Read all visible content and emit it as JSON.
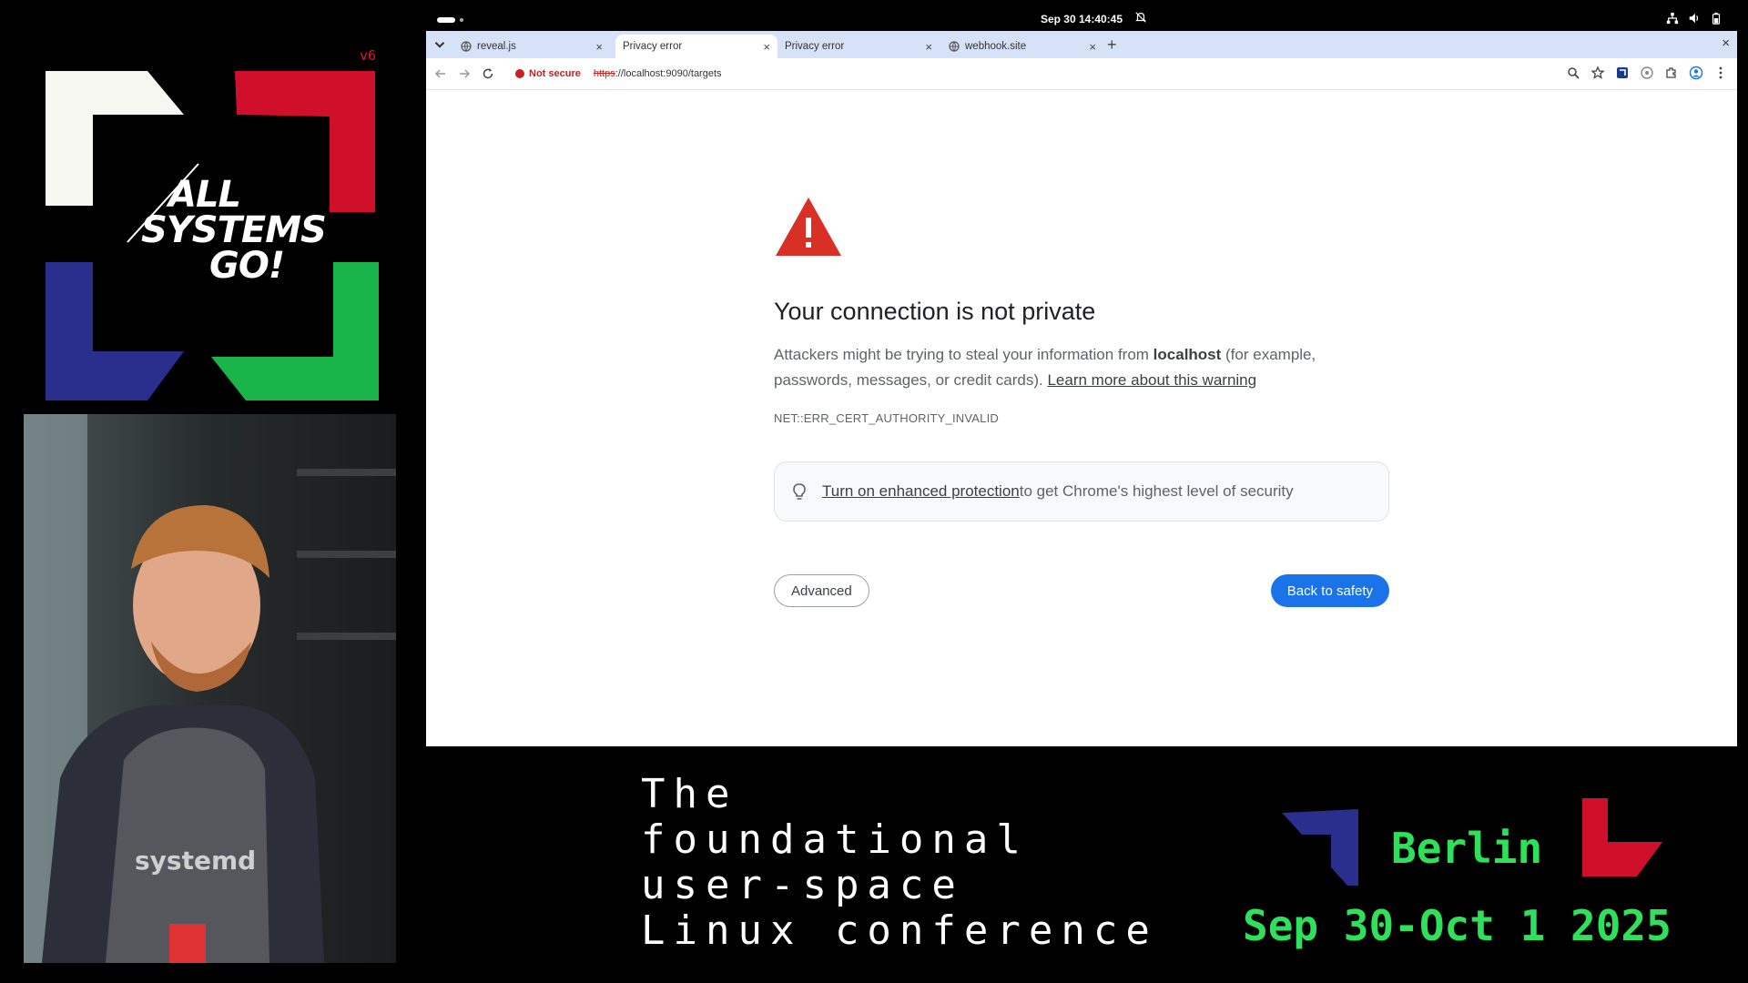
{
  "branding": {
    "version": "v6",
    "logo_lines": [
      "ALL",
      "SYSTEMS",
      "GO!"
    ],
    "colors": {
      "white": "#f7f7f2",
      "red": "#d0102a",
      "blue": "#2a2e8c",
      "green": "#19b54a",
      "accent_green": "#2fe05a"
    }
  },
  "footer": {
    "tagline": [
      "The",
      "foundational",
      "user-space",
      "Linux conference"
    ],
    "city": "Berlin",
    "dates": "Sep 30-Oct 1 2025"
  },
  "speaker": {
    "shirt_text": "systemd"
  },
  "system_bar": {
    "clock": "Sep 30  14:40:45",
    "tray_icons": [
      "network-icon",
      "volume-icon",
      "battery-icon"
    ]
  },
  "browser": {
    "tabs": [
      {
        "title": "reveal.js",
        "active": false
      },
      {
        "title": "Privacy error",
        "active": true
      },
      {
        "title": "Privacy error",
        "active": false
      },
      {
        "title": "webhook.site",
        "active": false
      }
    ],
    "new_tab": "+",
    "close": "×",
    "security_chip": "Not secure",
    "url_scheme": "https",
    "url_rest": "://localhost:9090/targets",
    "colors": {
      "primary_button": "#1a73e8",
      "danger": "#c5221f",
      "tab_strip": "#d6e2f7"
    }
  },
  "interstitial": {
    "heading": "Your connection is not private",
    "explanation_part1": "Attackers might be trying to steal your information from ",
    "host": "localhost",
    "explanation_part2": " (for example, passwords, messages, or credit cards). ",
    "learn_more": "Learn more about this warning",
    "error_code": "NET::ERR_CERT_AUTHORITY_INVALID",
    "promo_link": "Turn on enhanced protection",
    "promo_text": " to get Chrome's highest level of security",
    "advanced_label": "Advanced",
    "back_label": "Back to safety"
  }
}
